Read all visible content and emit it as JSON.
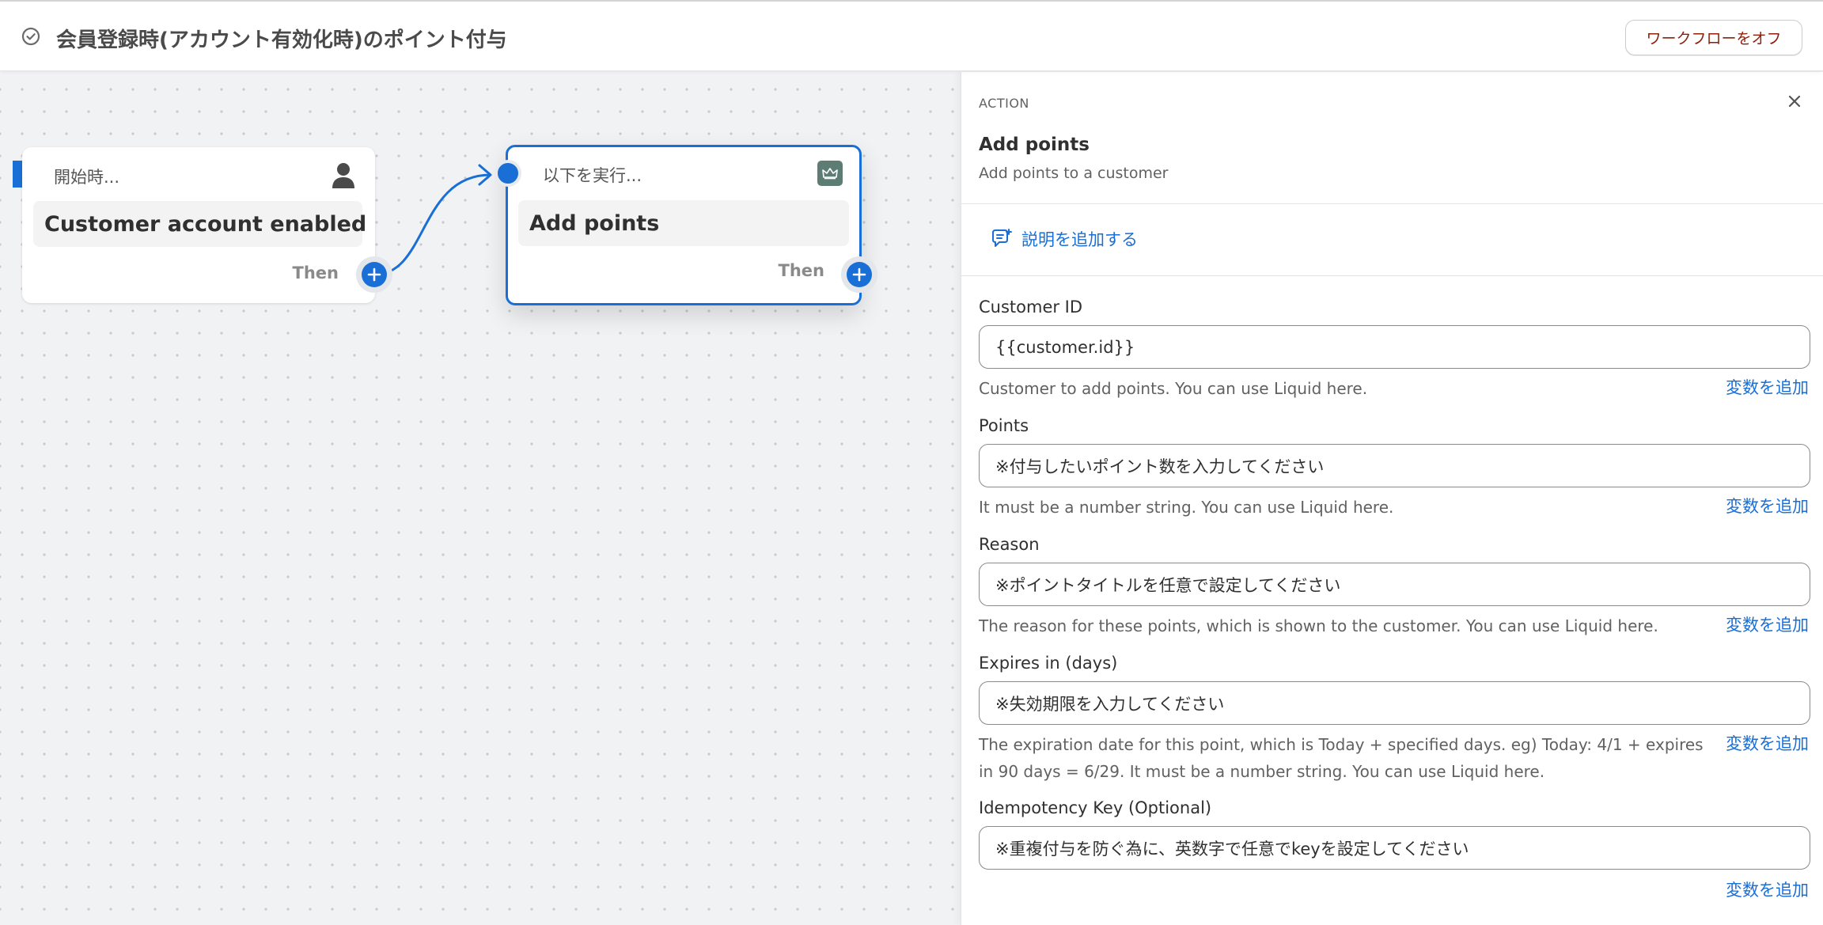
{
  "header": {
    "status_icon": "check-circle-icon",
    "title": "会員登録時(アカウント有効化時)のポイント付与",
    "off_button": "ワークフローをオフ"
  },
  "canvas": {
    "trigger_node": {
      "label": "開始時...",
      "title": "Customer account enabled",
      "then": "Then",
      "icon": "person-icon"
    },
    "action_node": {
      "label": "以下を実行...",
      "title": "Add points",
      "then": "Then",
      "icon": "crown-icon"
    }
  },
  "panel": {
    "kicker": "ACTION",
    "title": "Add points",
    "subtitle": "Add points to a customer",
    "add_description": "説明を追加する",
    "fields": [
      {
        "label": "Customer ID",
        "value": "{{customer.id}}",
        "help": "Customer to add points. You can use Liquid here.",
        "add_variable": "変数を追加"
      },
      {
        "label": "Points",
        "value": "※付与したいポイント数を入力してください",
        "help": "It must be a number string. You can use Liquid here.",
        "add_variable": "変数を追加"
      },
      {
        "label": "Reason",
        "value": "※ポイントタイトルを任意で設定してください",
        "help": "The reason for these points, which is shown to the customer. You can use Liquid here.",
        "add_variable": "変数を追加"
      },
      {
        "label": "Expires in (days)",
        "value": "※失効期限を入力してください",
        "help": "The expiration date for this point, which is Today + specified days. eg) Today: 4/1 + expires in 90 days = 6/29. It must be a number string. You can use Liquid here.",
        "add_variable": "変数を追加"
      },
      {
        "label": "Idempotency Key (Optional)",
        "value": "※重複付与を防ぐ為に、英数字で任意でkeyを設定してください",
        "help": "",
        "add_variable": "変数を追加"
      }
    ]
  },
  "colors": {
    "accent": "#1a6fd6",
    "danger_text": "#8e1f0b",
    "canvas_bg": "#f1f2f4"
  }
}
